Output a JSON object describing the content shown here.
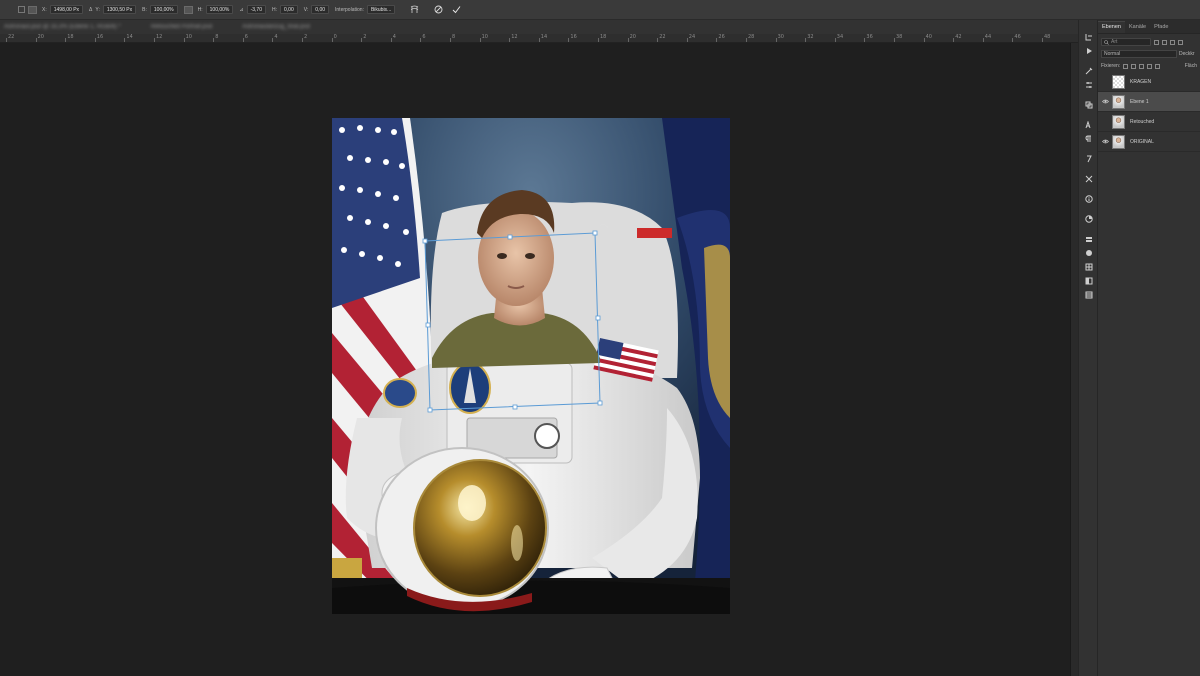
{
  "options_bar": {
    "x_label": "X:",
    "x_value": "1498,00 Px",
    "y_label": "Y:",
    "y_value": "1300,50 Px",
    "w_label": "B:",
    "w_value": "100,00%",
    "h_label": "H:",
    "h_value": "100,00%",
    "angle_label": "⊿",
    "angle_value": "-3,70",
    "hskew_label": "H:",
    "hskew_value": "0,00",
    "vskew_label": "V:",
    "vskew_value": "0,00",
    "interp_label": "Interpolation:",
    "interp_value": "Bikubis...",
    "cancel_icon": "cancel-icon",
    "commit_icon": "checkmark-icon"
  },
  "document_tabs": [
    "Astronaut.psd @ 33,3% (Ebene 1, RGB/8) *",
    "Retouched Portrait.psd",
    "Astronautanzug_final.psd"
  ],
  "ruler_labels": [
    "22",
    "20",
    "18",
    "16",
    "14",
    "12",
    "10",
    "8",
    "6",
    "4",
    "2",
    "0",
    "2",
    "4",
    "6",
    "8",
    "10",
    "12",
    "14",
    "16",
    "18",
    "20",
    "22",
    "24",
    "26",
    "28",
    "30",
    "32",
    "34",
    "36",
    "38",
    "40",
    "42",
    "44",
    "46",
    "48"
  ],
  "layers_panel": {
    "tabs": [
      "Ebenen",
      "Kanäle",
      "Pfade"
    ],
    "active_tab": 0,
    "search_placeholder": "Art",
    "blend_mode": "Normal",
    "opacity_label": "Deckkr",
    "lock_label": "Fixieren:",
    "fill_label": "Fläch",
    "layers": [
      {
        "name": "KRAGEN",
        "visible": false,
        "selected": false,
        "thumb": "transparent"
      },
      {
        "name": "Ebene 1",
        "visible": true,
        "selected": true,
        "thumb": "photo"
      },
      {
        "name": "Retouched",
        "visible": false,
        "selected": false,
        "thumb": "photo"
      },
      {
        "name": "ORIGINAL",
        "visible": true,
        "selected": false,
        "thumb": "photo"
      }
    ]
  },
  "colors": {
    "app_bg": "#1f1f1f",
    "panel_bg": "#323232",
    "selection": "#4b4b4b",
    "transform_handle": "#5b9bd5"
  }
}
